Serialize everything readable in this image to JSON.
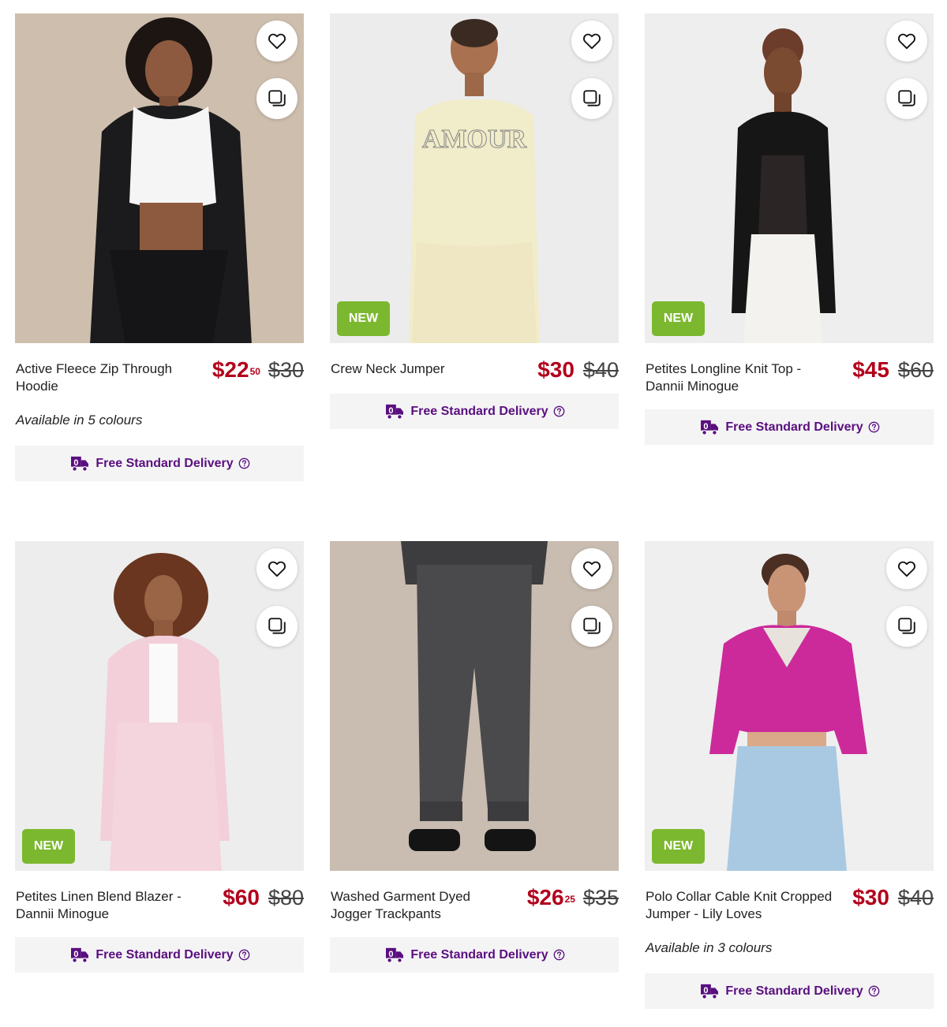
{
  "accent": {
    "price": "#b3001b",
    "delivery": "#5a0f7f",
    "badge": "#7cb82f"
  },
  "delivery_label": "Free Standard Delivery",
  "products": [
    {
      "name": "Active Fleece Zip Through Hoodie",
      "price": "$22",
      "cents": "50",
      "was": "$30",
      "badge": "",
      "colours": "Available in 5 colours",
      "icon": "hoodie-photo"
    },
    {
      "name": "Crew Neck Jumper",
      "price": "$30",
      "cents": "",
      "was": "$40",
      "badge": "NEW",
      "colours": "",
      "icon": "jumper-photo"
    },
    {
      "name": "Petites Longline Knit Top - Dannii Minogue",
      "price": "$45",
      "cents": "",
      "was": "$60",
      "badge": "NEW",
      "colours": "",
      "icon": "knit-top-photo"
    },
    {
      "name": "Petites Linen Blend Blazer - Dannii Minogue",
      "price": "$60",
      "cents": "",
      "was": "$80",
      "badge": "NEW",
      "colours": "",
      "icon": "blazer-photo"
    },
    {
      "name": "Washed Garment Dyed Jogger Trackpants",
      "price": "$26",
      "cents": "25",
      "was": "$35",
      "badge": "",
      "colours": "",
      "icon": "trackpants-photo"
    },
    {
      "name": "Polo Collar Cable Knit Cropped Jumper - Lily Loves",
      "price": "$30",
      "cents": "",
      "was": "$40",
      "badge": "NEW",
      "colours": "Available in 3 colours",
      "icon": "cable-knit-photo"
    }
  ]
}
